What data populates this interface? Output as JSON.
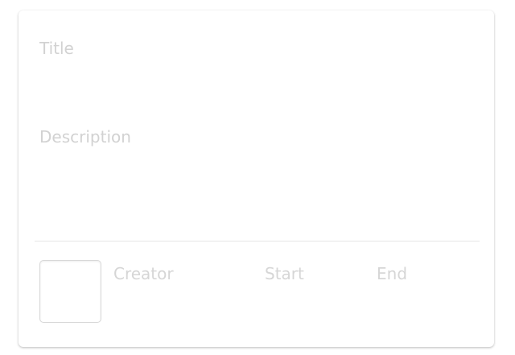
{
  "form": {
    "title_value": "",
    "title_placeholder": "Title",
    "description_value": "",
    "description_placeholder": "Description"
  },
  "meta": {
    "creator_label": "Creator",
    "start_label": "Start",
    "end_label": "End"
  }
}
